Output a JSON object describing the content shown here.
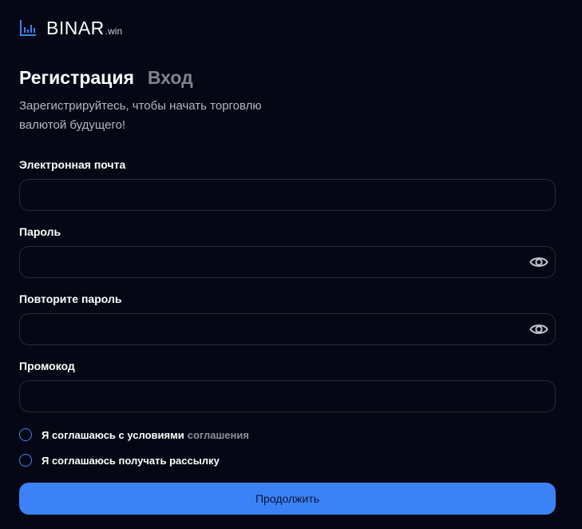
{
  "brand": {
    "name": "BINAR",
    "suffix": ".win",
    "icon": "bar-chart-icon"
  },
  "tabs": [
    {
      "label": "Регистрация",
      "active": true
    },
    {
      "label": "Вход",
      "active": false
    }
  ],
  "subtitle": "Зарегистрируйтесь, чтобы начать торговлю валютой будущего!",
  "form": {
    "email_label": "Электронная почта",
    "email_value": "",
    "password_label": "Пароль",
    "password_value": "",
    "repeat_password_label": "Повторите пароль",
    "repeat_password_value": "",
    "promo_label": "Промокод",
    "promo_value": "",
    "eye_icon": "eye-icon"
  },
  "checks": {
    "terms_text": "Я соглашаюсь с условиями",
    "terms_link": "соглашения",
    "newsletter_text": "Я соглашаюсь получать рассылку"
  },
  "submit_label": "Продолжить",
  "colors": {
    "background": "#050814",
    "accent": "#3b82f6",
    "field_border": "#262b39",
    "muted_text": "#80848f"
  }
}
